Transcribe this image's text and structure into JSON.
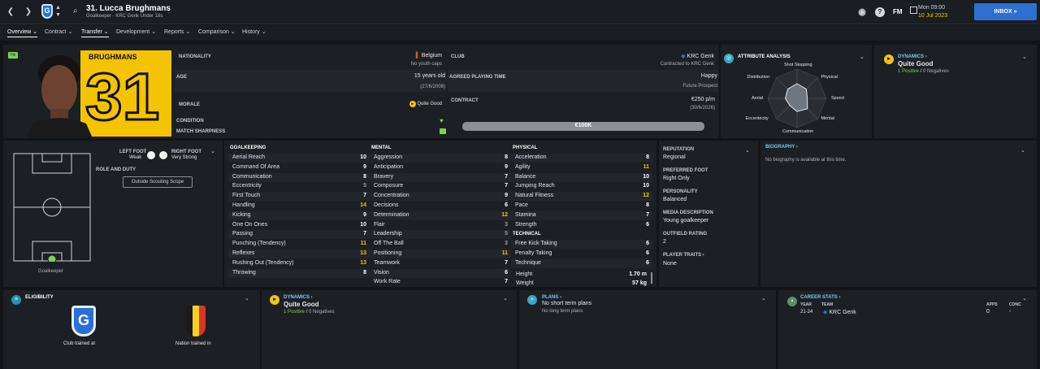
{
  "header": {
    "title": "31. Lucca Brughmans",
    "subtitle": "Goalkeeper - KRC Genk Under 18s",
    "date_line1": "Mon 09:00",
    "date_line2": "10 Jul 2023",
    "fm_logo": "FM",
    "inbox_label": "INBOX"
  },
  "tabs": [
    {
      "label": "Overview"
    },
    {
      "label": "Contract"
    },
    {
      "label": "Transfer"
    },
    {
      "label": "Development"
    },
    {
      "label": "Reports"
    },
    {
      "label": "Comparison"
    },
    {
      "label": "History"
    }
  ],
  "profile": {
    "badge": "Yth",
    "shirt_name": "BRUGHMANS",
    "shirt_number": "31"
  },
  "info": {
    "nationality_label": "NATIONALITY",
    "nationality": "Belgium",
    "youth_caps": "No youth caps",
    "age_label": "AGE",
    "age": "15 years old",
    "dob": "(27/6/2008)",
    "morale_label": "MORALE",
    "morale": "Quite Good",
    "condition_label": "CONDITION",
    "sharpness_label": "MATCH SHARPNESS",
    "club_label": "CLUB",
    "club": "KRC Genk",
    "club_status": "Contracted to KRC Genk",
    "playing_time_label": "AGREED PLAYING TIME",
    "playing_time": "Happy",
    "playing_time_sub": "Future Prospect",
    "contract_label": "CONTRACT",
    "wage": "€250 p/m",
    "contract_end": "(30/6/2026)",
    "value": "€100K"
  },
  "attribute_analysis": {
    "title": "ATTRIBUTE ANALYSIS",
    "labels": [
      "Shot Stopping",
      "Physical",
      "Speed",
      "Mental",
      "Communication",
      "Eccentricity",
      "Aerial",
      "Distribution"
    ],
    "levels": [
      0.5,
      0.45,
      0.35,
      0.5,
      0.45,
      0.35,
      0.4,
      0.45
    ]
  },
  "dynamics_top": {
    "title": "DYNAMICS",
    "value": "Quite Good",
    "positives": "1 Positive",
    "sep": "/",
    "negatives": "0 Negatives"
  },
  "feet": {
    "left_label": "LEFT FOOT",
    "left_value": "Weak",
    "right_label": "RIGHT FOOT",
    "right_value": "Very Strong",
    "role_label": "ROLE AND DUTY",
    "scout_button": "Outside Scouting Scope",
    "position_label": "Goalkeeper"
  },
  "goalkeeping": {
    "title": "GOALKEEPING",
    "items": [
      {
        "name": "Aerial Reach",
        "value": "10"
      },
      {
        "name": "Command Of Area",
        "value": "9"
      },
      {
        "name": "Communication",
        "value": "8"
      },
      {
        "name": "Eccentricity",
        "value": "5"
      },
      {
        "name": "First Touch",
        "value": "7"
      },
      {
        "name": "Handling",
        "value": "14"
      },
      {
        "name": "Kicking",
        "value": "9"
      },
      {
        "name": "One On Ones",
        "value": "10"
      },
      {
        "name": "Passing",
        "value": "7"
      },
      {
        "name": "Punching (Tendency)",
        "value": "11"
      },
      {
        "name": "Reflexes",
        "value": "13"
      },
      {
        "name": "Rushing Out (Tendency)",
        "value": "13"
      },
      {
        "name": "Throwing",
        "value": "8"
      }
    ]
  },
  "mental": {
    "title": "MENTAL",
    "items": [
      {
        "name": "Aggression",
        "value": "8"
      },
      {
        "name": "Anticipation",
        "value": "9"
      },
      {
        "name": "Bravery",
        "value": "7"
      },
      {
        "name": "Composure",
        "value": "7"
      },
      {
        "name": "Concentration",
        "value": "9"
      },
      {
        "name": "Decisions",
        "value": "6"
      },
      {
        "name": "Determination",
        "value": "12"
      },
      {
        "name": "Flair",
        "value": "3"
      },
      {
        "name": "Leadership",
        "value": "5"
      },
      {
        "name": "Off The Ball",
        "value": "3"
      },
      {
        "name": "Positioning",
        "value": "11"
      },
      {
        "name": "Teamwork",
        "value": "7"
      },
      {
        "name": "Vision",
        "value": "6"
      },
      {
        "name": "Work Rate",
        "value": "7"
      }
    ]
  },
  "physical": {
    "title": "PHYSICAL",
    "items": [
      {
        "name": "Acceleration",
        "value": "8"
      },
      {
        "name": "Agility",
        "value": "11"
      },
      {
        "name": "Balance",
        "value": "10"
      },
      {
        "name": "Jumping Reach",
        "value": "10"
      },
      {
        "name": "Natural Fitness",
        "value": "12"
      },
      {
        "name": "Pace",
        "value": "8"
      },
      {
        "name": "Stamina",
        "value": "7"
      },
      {
        "name": "Strength",
        "value": "6"
      }
    ]
  },
  "technical": {
    "title": "TECHNICAL",
    "items": [
      {
        "name": "Free Kick Taking",
        "value": "6"
      },
      {
        "name": "Penalty Taking",
        "value": "6"
      },
      {
        "name": "Technique",
        "value": "6"
      }
    ]
  },
  "body": {
    "height_label": "Height",
    "height": "1.70 m",
    "weight_label": "Weight",
    "weight": "57 kg"
  },
  "side_info": {
    "reputation_label": "REPUTATION",
    "reputation": "Regional",
    "foot_label": "PREFERRED FOOT",
    "foot": "Right Only",
    "personality_label": "PERSONALITY",
    "personality": "Balanced",
    "media_label": "MEDIA DESCRIPTION",
    "media": "Young goalkeeper",
    "outfield_label": "OUTFIELD RATING",
    "outfield": "2",
    "traits_label": "PLAYER TRAITS",
    "traits": "None"
  },
  "biography": {
    "title": "BIOGRAPHY",
    "text": "No biography is available at this time."
  },
  "eligibility": {
    "title": "ELIGIBILITY",
    "club_label": "Club trained at",
    "nation_label": "Nation trained in"
  },
  "dynamics_bottom": {
    "title": "DYNAMICS",
    "value": "Quite Good",
    "positives": "1 Positive",
    "sep": "/",
    "negatives": "0 Negatives"
  },
  "plans": {
    "title": "PLANS",
    "short": "No short term plans",
    "long": "No long term plans"
  },
  "career": {
    "title": "CAREER STATS",
    "col_year": "YEAR",
    "col_team": "TEAM",
    "col_apps": "APPS",
    "col_conc": "CONC",
    "row": {
      "year": "21-24",
      "team": "KRC Genk",
      "apps": "0",
      "conc": "-"
    }
  },
  "colors": {
    "accent": "#f1c40f",
    "positive": "#7fd34a",
    "primary": "#2f6fd1"
  }
}
